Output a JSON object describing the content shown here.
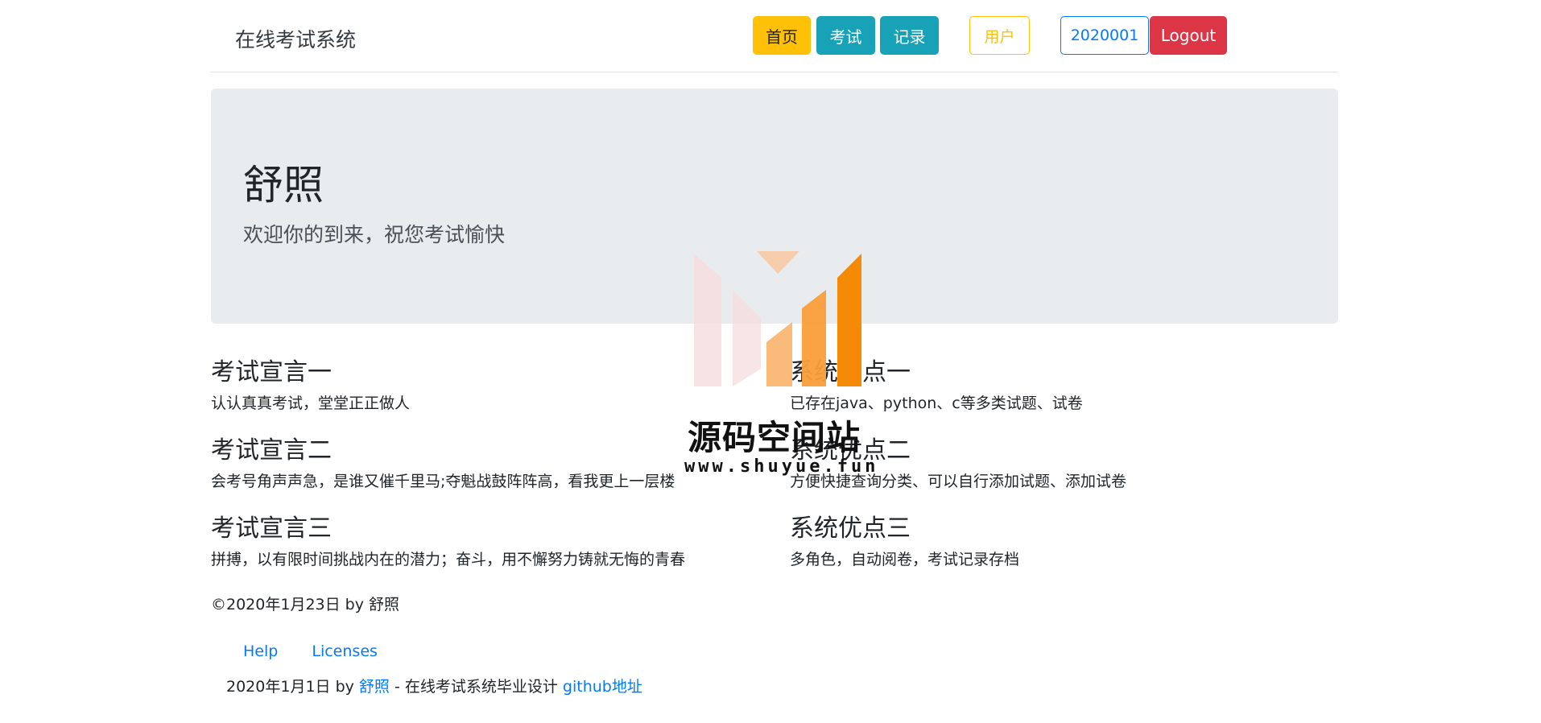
{
  "header": {
    "brand": "在线考试系统",
    "nav": {
      "home": "首页",
      "exam": "考试",
      "record": "记录",
      "user": "用户",
      "user_id": "2020001",
      "logout": "Logout"
    }
  },
  "jumbotron": {
    "title": "舒照",
    "lead": "欢迎你的到来，祝您考试愉快"
  },
  "features": {
    "left": [
      {
        "title": "考试宣言一",
        "text": "认认真真考试，堂堂正正做人"
      },
      {
        "title": "考试宣言二",
        "text": "会考号角声声急，是谁又催千里马;夺魁战鼓阵阵高，看我更上一层楼"
      },
      {
        "title": "考试宣言三",
        "text": "拼搏，以有限时间挑战内在的潜力；奋斗，用不懈努力铸就无悔的青春"
      }
    ],
    "right": [
      {
        "title": "系统优点一",
        "text": "已存在java、python、c等多类试题、试卷"
      },
      {
        "title": "系统优点二",
        "text": "方便快捷查询分类、可以自行添加试题、添加试卷"
      },
      {
        "title": "系统优点三",
        "text": "多角色，自动阅卷，考试记录存档"
      }
    ]
  },
  "copyright": "©2020年1月23日 by 舒照",
  "footer": {
    "links": [
      "Help",
      "Licenses"
    ],
    "line_prefix": "2020年1月1日 by ",
    "author_link": "舒照",
    "line_middle": " - 在线考试系统毕业设计 ",
    "github_link": "github地址"
  },
  "watermark": {
    "title": "源码空间站",
    "url": "www.shuyue.fun"
  },
  "colors": {
    "warning": "#ffc107",
    "info": "#17a2b8",
    "primary": "#007bff",
    "danger": "#dc3545",
    "jumbotron_bg": "#e9ecef"
  }
}
